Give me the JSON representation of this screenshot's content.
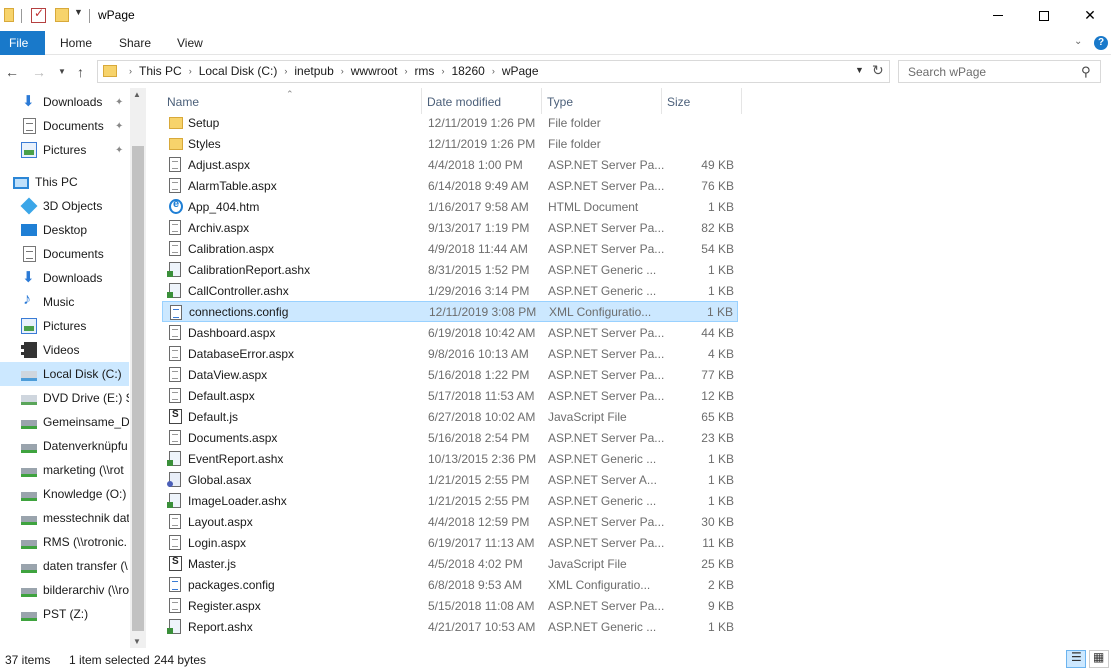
{
  "window": {
    "title": "wPage",
    "min_label": "",
    "close_label": "✕"
  },
  "ribbon": {
    "tabs": [
      "File",
      "Home",
      "Share",
      "View"
    ],
    "help": "?"
  },
  "address": {
    "crumbs": [
      "This PC",
      "Local Disk (C:)",
      "inetpub",
      "wwwroot",
      "rms",
      "18260",
      "wPage"
    ]
  },
  "search": {
    "placeholder": "Search wPage"
  },
  "nav": {
    "items": [
      {
        "label": "Downloads",
        "icon": "downloads-icon",
        "pinned": true
      },
      {
        "label": "Documents",
        "icon": "documents-icon",
        "pinned": true
      },
      {
        "label": "Pictures",
        "icon": "pictures-icon",
        "pinned": true
      },
      {
        "label": "This PC",
        "icon": "this-pc-icon"
      },
      {
        "label": "3D Objects",
        "icon": "3d-objects-icon"
      },
      {
        "label": "Desktop",
        "icon": "desktop-icon"
      },
      {
        "label": "Documents",
        "icon": "documents-icon"
      },
      {
        "label": "Downloads",
        "icon": "downloads-icon"
      },
      {
        "label": "Music",
        "icon": "music-icon"
      },
      {
        "label": "Pictures",
        "icon": "pictures-icon"
      },
      {
        "label": "Videos",
        "icon": "videos-icon"
      },
      {
        "label": "Local Disk (C:)",
        "icon": "local-disk-icon",
        "selected": true
      },
      {
        "label": "DVD Drive (E:) SS",
        "icon": "dvd-drive-icon"
      },
      {
        "label": "Gemeinsame_Da",
        "icon": "network-drive-icon"
      },
      {
        "label": "Datenverknüpfu",
        "icon": "network-drive-icon"
      },
      {
        "label": "marketing (\\\\rot",
        "icon": "network-drive-icon"
      },
      {
        "label": "Knowledge (O:)",
        "icon": "network-drive-icon"
      },
      {
        "label": "messtechnik dat",
        "icon": "network-drive-icon"
      },
      {
        "label": "RMS (\\\\rotronic.",
        "icon": "network-drive-icon"
      },
      {
        "label": "daten transfer (\\",
        "icon": "network-drive-icon"
      },
      {
        "label": "bilderarchiv (\\\\ro",
        "icon": "network-drive-icon"
      },
      {
        "label": "PST (Z:)",
        "icon": "network-drive-icon"
      }
    ]
  },
  "columns": {
    "name": "Name",
    "date": "Date modified",
    "type": "Type",
    "size": "Size"
  },
  "files": [
    {
      "name": "Setup",
      "date": "12/11/2019 1:26 PM",
      "type": "File folder",
      "size": "",
      "kind": "folder"
    },
    {
      "name": "Styles",
      "date": "12/11/2019 1:26 PM",
      "type": "File folder",
      "size": "",
      "kind": "folder"
    },
    {
      "name": "Adjust.aspx",
      "date": "4/4/2018 1:00 PM",
      "type": "ASP.NET Server Pa...",
      "size": "49 KB",
      "kind": "aspx"
    },
    {
      "name": "AlarmTable.aspx",
      "date": "6/14/2018 9:49 AM",
      "type": "ASP.NET Server Pa...",
      "size": "76 KB",
      "kind": "aspx"
    },
    {
      "name": "App_404.htm",
      "date": "1/16/2017 9:58 AM",
      "type": "HTML Document",
      "size": "1 KB",
      "kind": "htm"
    },
    {
      "name": "Archiv.aspx",
      "date": "9/13/2017 1:19 PM",
      "type": "ASP.NET Server Pa...",
      "size": "82 KB",
      "kind": "aspx"
    },
    {
      "name": "Calibration.aspx",
      "date": "4/9/2018 11:44 AM",
      "type": "ASP.NET Server Pa...",
      "size": "54 KB",
      "kind": "aspx"
    },
    {
      "name": "CalibrationReport.ashx",
      "date": "8/31/2015 1:52 PM",
      "type": "ASP.NET Generic ...",
      "size": "1 KB",
      "kind": "ashx"
    },
    {
      "name": "CallController.ashx",
      "date": "1/29/2016 3:14 PM",
      "type": "ASP.NET Generic ...",
      "size": "1 KB",
      "kind": "ashx"
    },
    {
      "name": "connections.config",
      "date": "12/11/2019 3:08 PM",
      "type": "XML Configuratio...",
      "size": "1 KB",
      "kind": "config",
      "selected": true
    },
    {
      "name": "Dashboard.aspx",
      "date": "6/19/2018 10:42 AM",
      "type": "ASP.NET Server Pa...",
      "size": "44 KB",
      "kind": "aspx"
    },
    {
      "name": "DatabaseError.aspx",
      "date": "9/8/2016 10:13 AM",
      "type": "ASP.NET Server Pa...",
      "size": "4 KB",
      "kind": "aspx"
    },
    {
      "name": "DataView.aspx",
      "date": "5/16/2018 1:22 PM",
      "type": "ASP.NET Server Pa...",
      "size": "77 KB",
      "kind": "aspx"
    },
    {
      "name": "Default.aspx",
      "date": "5/17/2018 11:53 AM",
      "type": "ASP.NET Server Pa...",
      "size": "12 KB",
      "kind": "aspx"
    },
    {
      "name": "Default.js",
      "date": "6/27/2018 10:02 AM",
      "type": "JavaScript File",
      "size": "65 KB",
      "kind": "js"
    },
    {
      "name": "Documents.aspx",
      "date": "5/16/2018 2:54 PM",
      "type": "ASP.NET Server Pa...",
      "size": "23 KB",
      "kind": "aspx"
    },
    {
      "name": "EventReport.ashx",
      "date": "10/13/2015 2:36 PM",
      "type": "ASP.NET Generic ...",
      "size": "1 KB",
      "kind": "ashx"
    },
    {
      "name": "Global.asax",
      "date": "1/21/2015 2:55 PM",
      "type": "ASP.NET Server A...",
      "size": "1 KB",
      "kind": "asax"
    },
    {
      "name": "ImageLoader.ashx",
      "date": "1/21/2015 2:55 PM",
      "type": "ASP.NET Generic ...",
      "size": "1 KB",
      "kind": "ashx"
    },
    {
      "name": "Layout.aspx",
      "date": "4/4/2018 12:59 PM",
      "type": "ASP.NET Server Pa...",
      "size": "30 KB",
      "kind": "aspx"
    },
    {
      "name": "Login.aspx",
      "date": "6/19/2017 11:13 AM",
      "type": "ASP.NET Server Pa...",
      "size": "11 KB",
      "kind": "aspx"
    },
    {
      "name": "Master.js",
      "date": "4/5/2018 4:02 PM",
      "type": "JavaScript File",
      "size": "25 KB",
      "kind": "js"
    },
    {
      "name": "packages.config",
      "date": "6/8/2018 9:53 AM",
      "type": "XML Configuratio...",
      "size": "2 KB",
      "kind": "config"
    },
    {
      "name": "Register.aspx",
      "date": "5/15/2018 11:08 AM",
      "type": "ASP.NET Server Pa...",
      "size": "9 KB",
      "kind": "aspx"
    },
    {
      "name": "Report.ashx",
      "date": "4/21/2017 10:53 AM",
      "type": "ASP.NET Generic ...",
      "size": "1 KB",
      "kind": "ashx"
    }
  ],
  "status": {
    "count": "37 items",
    "selected": "1 item selected",
    "size": "244 bytes"
  }
}
